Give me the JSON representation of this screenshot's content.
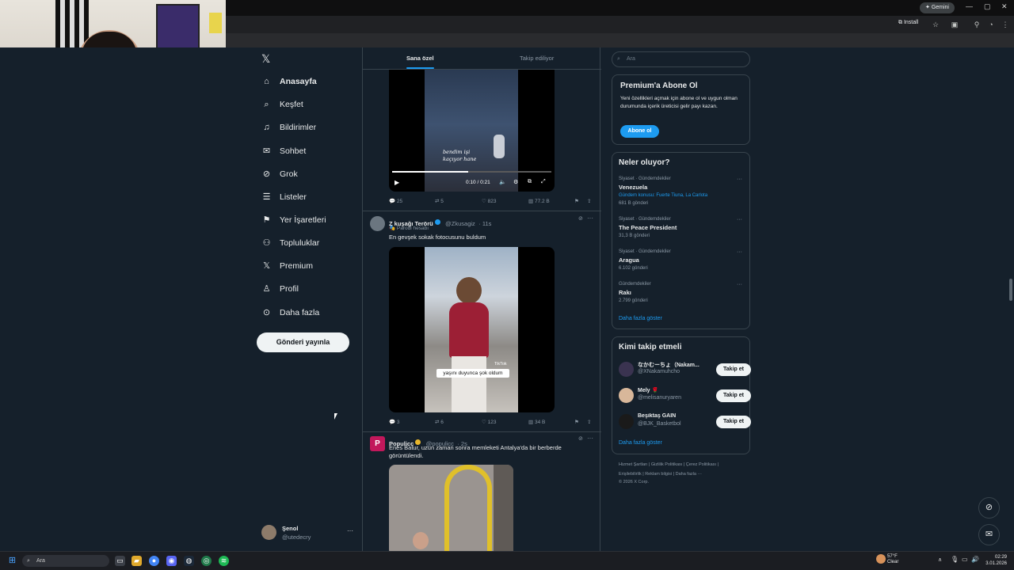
{
  "browser": {
    "gemini_label": "Gemini",
    "install_label": "Install",
    "win_min": "—",
    "win_max": "▢",
    "win_close": "✕"
  },
  "nav": {
    "items": [
      {
        "label": "Anasayfa",
        "icon": "home-icon"
      },
      {
        "label": "Keşfet",
        "icon": "search-icon"
      },
      {
        "label": "Bildirimler",
        "icon": "bell-icon"
      },
      {
        "label": "Sohbet",
        "icon": "mail-icon"
      },
      {
        "label": "Grok",
        "icon": "grok-icon"
      },
      {
        "label": "Listeler",
        "icon": "list-icon"
      },
      {
        "label": "Yer İşaretleri",
        "icon": "bookmark-icon"
      },
      {
        "label": "Topluluklar",
        "icon": "people-icon"
      },
      {
        "label": "Premium",
        "icon": "x-logo-icon"
      },
      {
        "label": "Profil",
        "icon": "person-icon"
      },
      {
        "label": "Daha fazla",
        "icon": "more-circle-icon"
      }
    ],
    "post_button": "Gönderi yayınla",
    "profile_name": "Şenol",
    "profile_handle": "@utedecry",
    "profile_more": "···"
  },
  "feed": {
    "tabs": [
      "Sana özel",
      "Takip ediliyor"
    ],
    "video1": {
      "caption": "bendim işi\nkaçıyor hane",
      "time": "0:10 / 0:21",
      "actions": {
        "reply": "25",
        "repost": "5",
        "like": "823",
        "views": "77.2 B"
      }
    },
    "tweet2": {
      "name": "Z kuşağı Terörü",
      "handle": "@Zkusagiz",
      "time": "· 11s",
      "badge": "Parodi hesabı",
      "text": "En gevşek sokak fotocusunu buldum",
      "overlay": "yaşını duyunca şok oldum",
      "tiktok": "TikTok",
      "actions": {
        "reply": "3",
        "repost": "6",
        "like": "123",
        "views": "34 B"
      }
    },
    "tweet3": {
      "name": "Populicc",
      "handle": "@populicc",
      "time": "· 2s",
      "text": "Enes Batur, uzun zaman sonra memleketi Antalya'da bir berberde görüntülendi."
    }
  },
  "right": {
    "search_placeholder": "Ara",
    "premium": {
      "title": "Premium'a Abone Ol",
      "text": "Yeni özellikleri açmak için abone ol ve uygun olman durumunda içerik üreticisi gelir payı kazan.",
      "button": "Abone ol"
    },
    "trends": {
      "title": "Neler oluyor?",
      "items": [
        {
          "meta": "Siyaset · Gündemdekiler",
          "name": "Venezuela",
          "sub": "Gündem konusu: Fuerte Tiuna, La Carlota",
          "count": "681 B gönderi"
        },
        {
          "meta": "Siyaset · Gündemdekiler",
          "name": "The Peace President",
          "sub": "",
          "count": "31,3 B gönderi"
        },
        {
          "meta": "Siyaset · Gündemdekiler",
          "name": "Aragua",
          "sub": "",
          "count": "6.102 gönderi"
        },
        {
          "meta": "Gündemdekiler",
          "name": "Rakı",
          "sub": "",
          "count": "2.799 gönderi"
        }
      ],
      "more": "Daha fazla göster"
    },
    "who": {
      "title": "Kimi takip etmeli",
      "items": [
        {
          "name": "なかむーちょ（Nakam...",
          "handle": "@XNakamuhcho",
          "btn": "Takip et"
        },
        {
          "name": "Mely 🌹",
          "handle": "@melisanuryaren",
          "btn": "Takip et"
        },
        {
          "name": "Beşiktaş GAİN",
          "handle": "@BJK_Basketbol",
          "btn": "Takip et"
        }
      ],
      "more": "Daha fazla göster"
    },
    "footer": {
      "line1": "Hizmet Şartları  |  Gizlilik Politikası  |  Çerez Politikası  |",
      "line2": "Erişilebilirlik  |  Reklam bilgisi  |  Daha fazla ···",
      "line3": "© 2026 X Corp."
    }
  },
  "taskbar": {
    "search": "Ara",
    "weather_temp": "57°F",
    "weather_cond": "Clear",
    "time": "02:29",
    "date": "3.01.2026"
  }
}
